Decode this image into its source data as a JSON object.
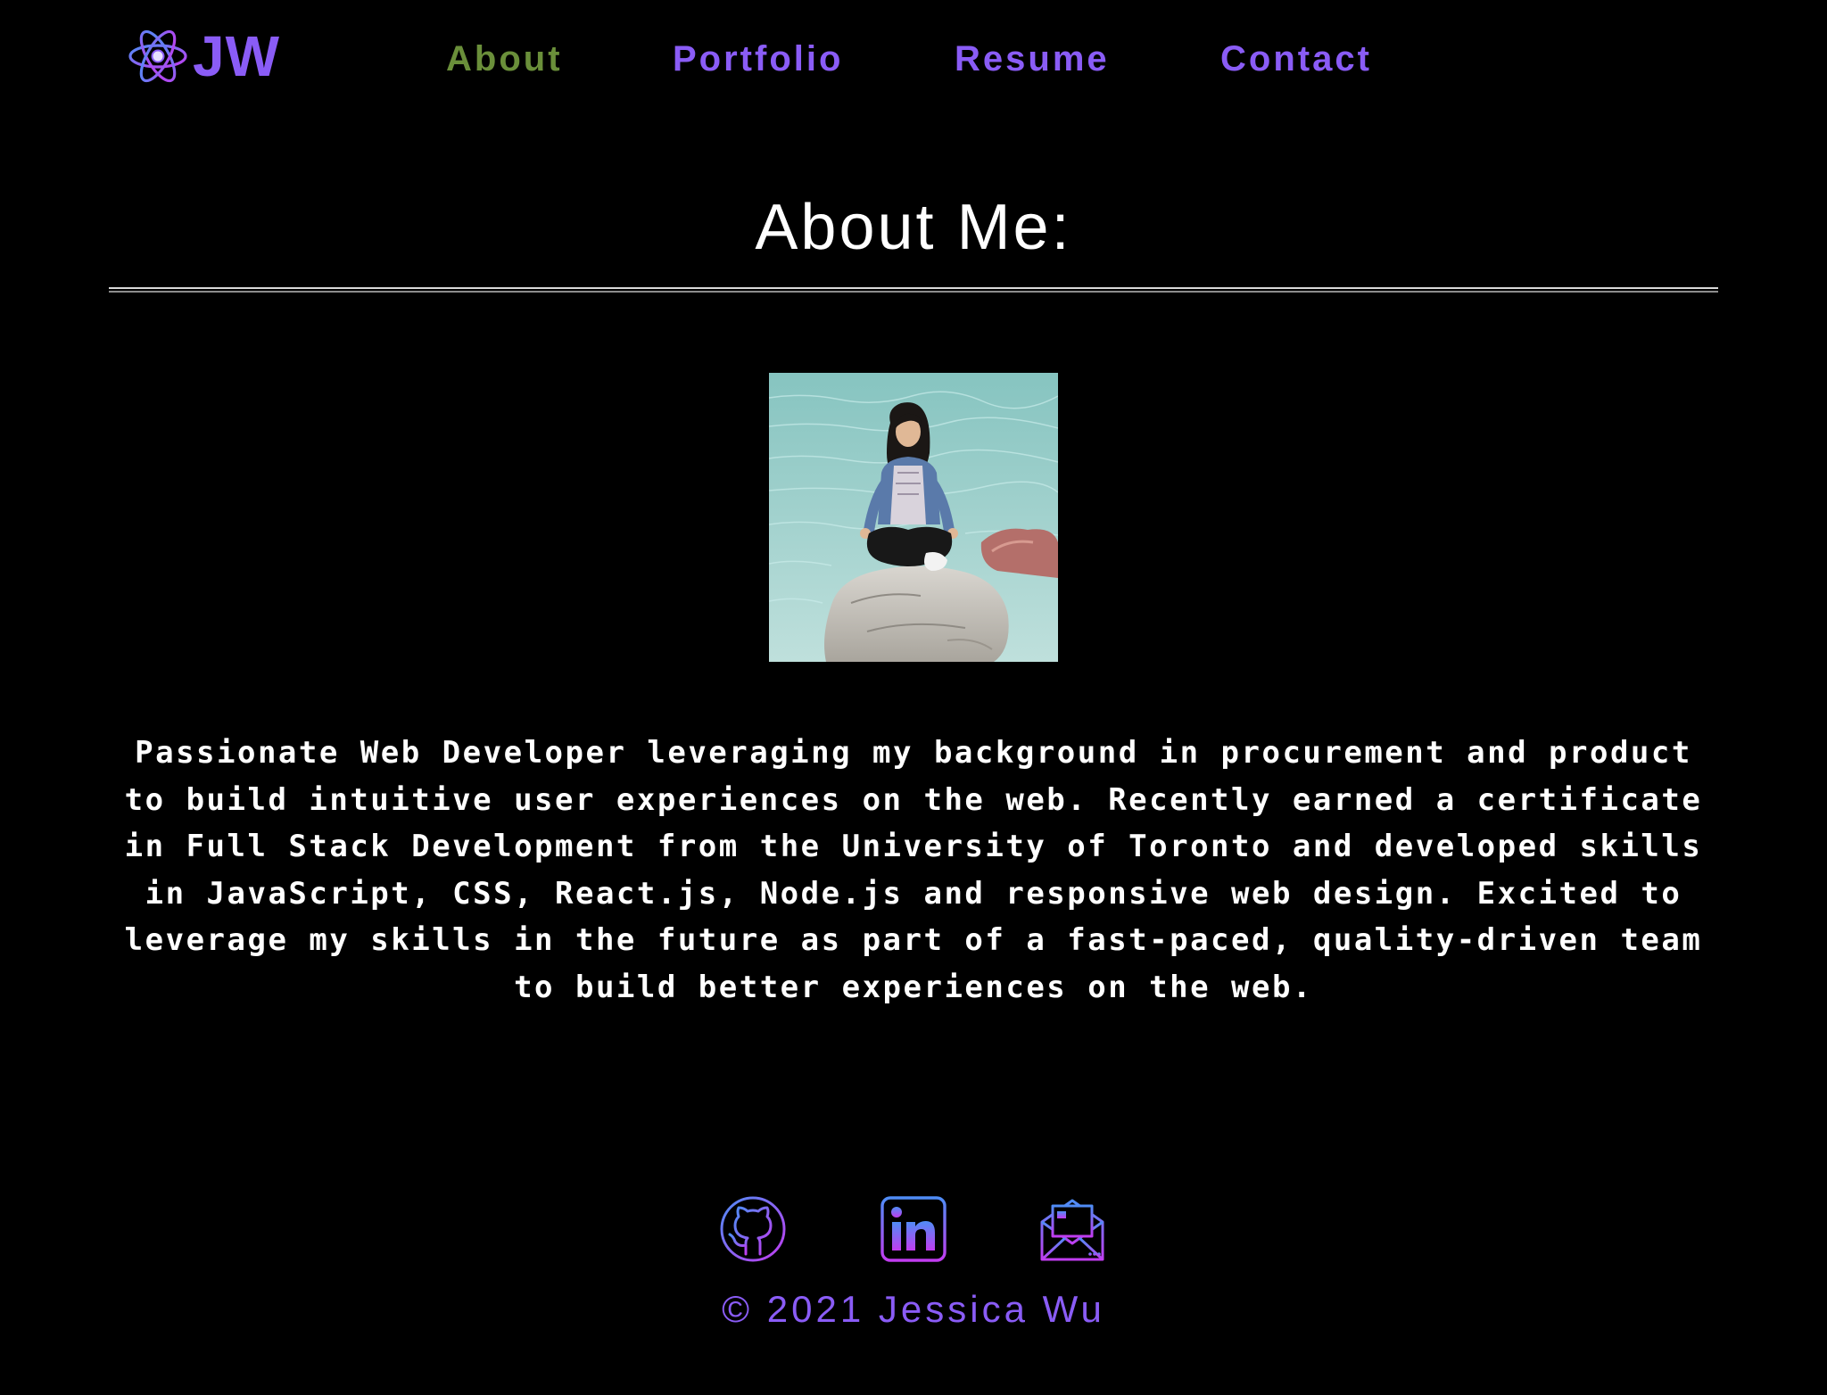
{
  "colors": {
    "background": "#000000",
    "brand_purple": "#8a5cf6",
    "active_green": "#6a8f3a",
    "text_white": "#ffffff",
    "gradient_blue": "#4f8df6",
    "gradient_magenta": "#c13cf0"
  },
  "header": {
    "logo": {
      "icon": "atom-icon",
      "text": "JW"
    },
    "nav": [
      {
        "label": "About",
        "active": true
      },
      {
        "label": "Portfolio",
        "active": false
      },
      {
        "label": "Resume",
        "active": false
      },
      {
        "label": "Contact",
        "active": false
      }
    ]
  },
  "main": {
    "title": "About Me:",
    "photo": {
      "subject": "person meditating cross-legged on a rock by turquoise water"
    },
    "bio": "Passionate Web Developer leveraging my background in procurement and product to build intuitive user experiences on the web. Recently earned a certificate in Full Stack Development from the University of Toronto and developed skills in JavaScript, CSS, React.js, Node.js and responsive web design. Excited to leverage my skills in the future as part of a fast-paced, quality-driven team to build better experiences on the web."
  },
  "footer": {
    "social": [
      {
        "icon": "github-icon"
      },
      {
        "icon": "linkedin-icon"
      },
      {
        "icon": "email-icon"
      }
    ],
    "copyright": "© 2021 Jessica Wu"
  }
}
